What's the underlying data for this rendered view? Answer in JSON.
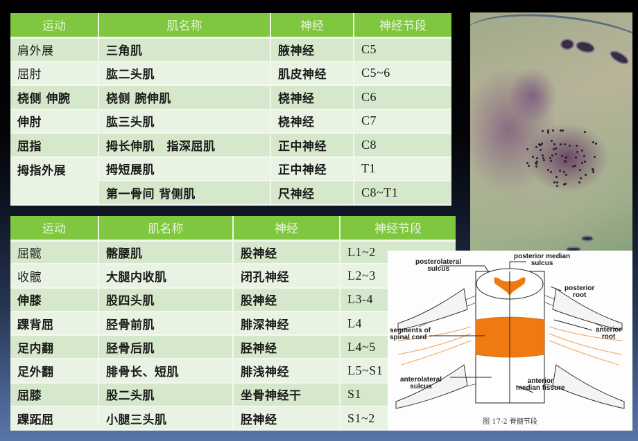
{
  "upper_limb_table": {
    "headers": [
      "运动",
      "肌名称",
      "神经",
      "神经节段"
    ],
    "rows": [
      {
        "movement": "肩外展",
        "muscle": "三角肌",
        "nerve": "腋神经",
        "segment": "C5"
      },
      {
        "movement": "屈肘",
        "muscle": "肱二头肌",
        "nerve": "肌皮神经",
        "segment": "C5~6"
      },
      {
        "movement": "桡侧 伸腕",
        "muscle": "桡侧 腕伸肌",
        "nerve": "桡神经",
        "segment": "C6"
      },
      {
        "movement": "伸肘",
        "muscle": "肱三头肌",
        "nerve": "桡神经",
        "segment": "C7"
      },
      {
        "movement": "屈指",
        "muscle": "拇长伸肌　指深屈肌",
        "nerve": "正中神经",
        "segment": "C8"
      },
      {
        "movement": "拇指外展",
        "muscle": "拇短展肌",
        "nerve": "正中神经",
        "segment": "T1"
      },
      {
        "movement": "",
        "muscle": "第一骨间 背侧肌",
        "nerve": "尺神经",
        "segment": "C8~T1"
      }
    ]
  },
  "lower_limb_table": {
    "headers": [
      "运动",
      "肌名称",
      "神经",
      "神经节段"
    ],
    "rows": [
      {
        "movement": "屈髋",
        "muscle": "髂腰肌",
        "nerve": "股神经",
        "segment": "L1~2"
      },
      {
        "movement": "收髋",
        "muscle": "大腿内收肌",
        "nerve": "闭孔神经",
        "segment": "L2~3"
      },
      {
        "movement": "伸膝",
        "muscle": "股四头肌",
        "nerve": "股神经",
        "segment": "L3-4"
      },
      {
        "movement": "踝背屈",
        "muscle": "胫骨前肌",
        "nerve": "腓深神经",
        "segment": "L4"
      },
      {
        "movement": "足内翻",
        "muscle": "胫骨后肌",
        "nerve": "胫神经",
        "segment": "L4~5"
      },
      {
        "movement": "足外翻",
        "muscle": "腓骨长、短肌",
        "nerve": "腓浅神经",
        "segment": "L5~S1"
      },
      {
        "movement": "屈膝",
        "muscle": "股二头肌",
        "nerve": "坐骨神经干",
        "segment": "S1"
      },
      {
        "movement": "踝跖屈",
        "muscle": "小腿三头肌",
        "nerve": "胫神经",
        "segment": "S1~2"
      }
    ]
  },
  "histology_photo": {
    "description": "spinal cord cross-section stained micrograph"
  },
  "diagram": {
    "labels": {
      "posterolateral_sulcus": [
        "posterolateral",
        "sulcus"
      ],
      "posterior_median_sulcus": [
        "posterior median",
        "sulcus"
      ],
      "posterior_root": [
        "posterior",
        "root"
      ],
      "segments_of_spinal_cord": [
        "segments of",
        "spinal cord"
      ],
      "anterior_root": [
        "anterior",
        "root"
      ],
      "anterolateral_sulcus": [
        "anterolateral",
        "sulcus"
      ],
      "anterior_median_fissure": [
        "anterior",
        "median fissure"
      ]
    },
    "caption": "图 17-2 脊髓节段",
    "highlight_color": "#f07a12"
  },
  "colors": {
    "header_green": "#7ec73e",
    "row_dark": "#d5e8cb",
    "row_light": "#e9f3e4"
  }
}
